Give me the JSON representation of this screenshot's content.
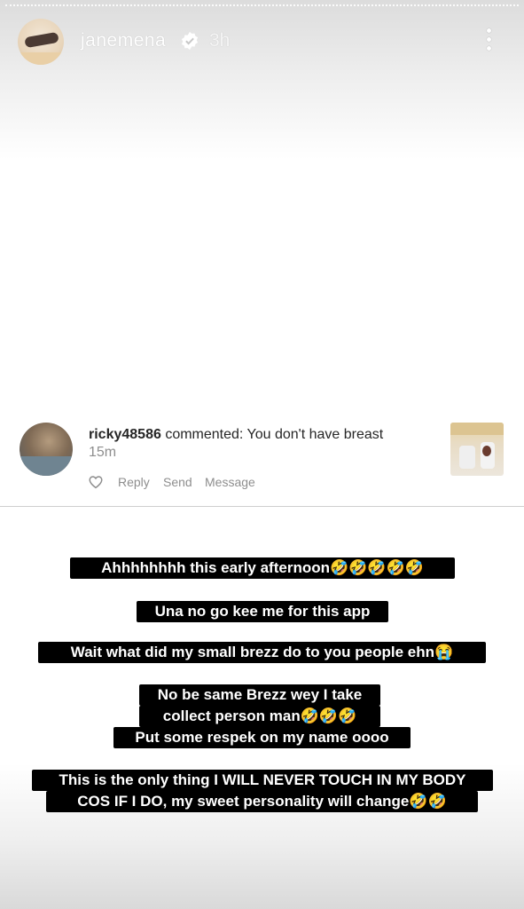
{
  "story": {
    "username": "janemena",
    "time_ago": "3h"
  },
  "comment": {
    "username": "ricky48586",
    "action": "commented:",
    "text": "You don't have breast",
    "time_ago": "15m",
    "actions": [
      "Reply",
      "Send",
      "Message"
    ]
  },
  "captions": {
    "line1": "Ahhhhhhhh this early afternoon🤣🤣🤣🤣🤣",
    "line2": "Una no go kee me for this app",
    "line3": "Wait what did my small brezz do to you people ehn😭",
    "line4a": "No be same Brezz wey I take",
    "line4b": "collect person man🤣🤣🤣",
    "line4c": "Put some respek on my name oooo",
    "line5a": "This is the only thing I WILL NEVER TOUCH IN MY BODY",
    "line5b": "COS IF I DO, my sweet personality will change🤣🤣"
  }
}
